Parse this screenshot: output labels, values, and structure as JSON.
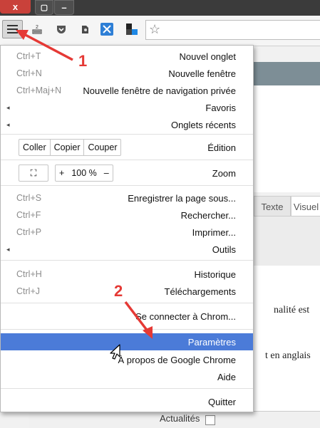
{
  "window": {
    "close_glyph": "x",
    "maximize_glyph": "▢",
    "minimize_glyph": "–"
  },
  "toolbar": {
    "icons": [
      "menu-icon",
      "battery-icon",
      "pocket-icon",
      "evernote-icon",
      "translate-icon",
      "blocks-icon",
      "star-icon"
    ]
  },
  "background_page": {
    "tabs": [
      "Visuel",
      "Texte"
    ],
    "texts": [
      "nalité est",
      "t en anglais"
    ],
    "checkbox_label": "Actualités"
  },
  "menu": {
    "items_top": [
      {
        "label": "Nouvel onglet",
        "shortcut": "Ctrl+T"
      },
      {
        "label": "Nouvelle fenêtre",
        "shortcut": "Ctrl+N"
      },
      {
        "label": "Nouvelle fenêtre de navigation privée",
        "shortcut": "Ctrl+Maj+N"
      },
      {
        "label": "Favoris",
        "submenu": "◂"
      },
      {
        "label": "Onglets récents",
        "submenu": "◂"
      }
    ],
    "edit": {
      "label": "Édition",
      "buttons": [
        "Couper",
        "Copier",
        "Coller"
      ]
    },
    "zoom": {
      "label": "Zoom",
      "minus": "–",
      "value": "100 %",
      "plus": "+",
      "fullscreen": "⛶"
    },
    "items_mid": [
      {
        "label": "Enregistrer la page sous...",
        "shortcut": "Ctrl+S"
      },
      {
        "label": "Rechercher...",
        "shortcut": "Ctrl+F"
      },
      {
        "label": "Imprimer...",
        "shortcut": "Ctrl+P"
      },
      {
        "label": "Outils",
        "submenu": "◂"
      }
    ],
    "items_hist": [
      {
        "label": "Historique",
        "shortcut": "Ctrl+H"
      },
      {
        "label": "Téléchargements",
        "shortcut": "Ctrl+J"
      }
    ],
    "signin": "Se connecter à Chrom...",
    "items_bottom": [
      {
        "label": "Paramètres",
        "highlighted": true
      },
      {
        "label": "À propos de Google Chrome"
      },
      {
        "label": "Aide"
      }
    ],
    "quit": "Quitter"
  },
  "annotations": {
    "step1": "1",
    "step2": "2",
    "color": "#e53935"
  },
  "colors": {
    "highlight": "#4b7bd8",
    "close": "#c9413a"
  }
}
